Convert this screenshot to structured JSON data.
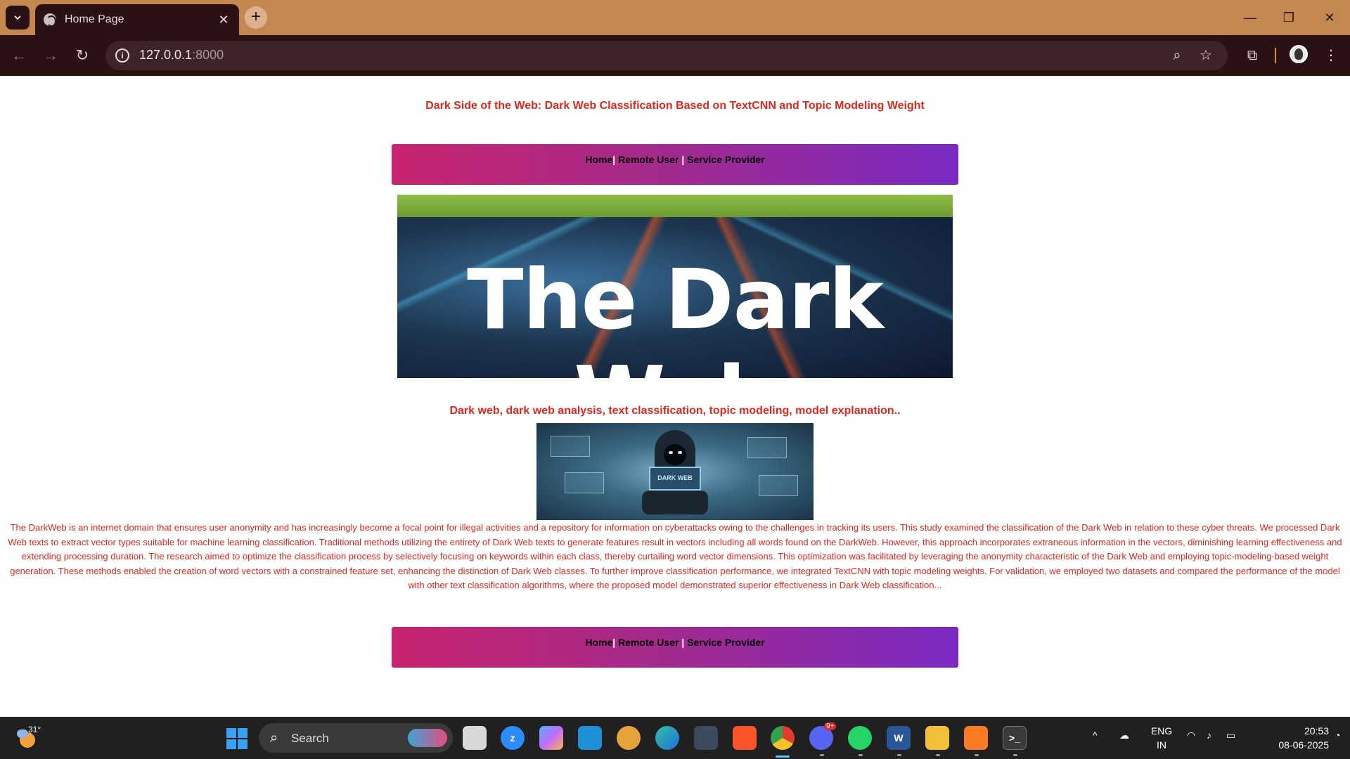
{
  "browser": {
    "tab_title": "Home Page",
    "url_host": "127.0.0.1",
    "url_port": ":8000"
  },
  "page": {
    "title": "Dark Side of the Web: Dark Web Classification Based on TextCNN and Topic Modeling Weight",
    "menu": {
      "home": "Home",
      "sep1": "|",
      "remote_user": "Remote User",
      "sep2": "|",
      "service_provider": "Service Provider"
    },
    "banner_text": "The Dark Web",
    "keywords": "Dark web, dark web analysis, text classification, topic modeling, model explanation..",
    "hacker_screen_text": "DARK WEB",
    "abstract": "The DarkWeb is an internet domain that ensures user anonymity and has increasingly become a focal point for illegal activities and a repository for information on cyberattacks owing to the challenges in tracking its users. This study examined the classification of the Dark Web in relation to these cyber threats. We processed Dark Web texts to extract vector types suitable for machine learning classification. Traditional methods utilizing the entirety of Dark Web texts to generate features result in vectors including all words found on the DarkWeb. However, this approach incorporates extraneous information in the vectors, diminishing learning effectiveness and extending processing duration. The research aimed to optimize the classification process by selectively focusing on keywords within each class, thereby curtailing word vector dimensions. This optimization was facilitated by leveraging the anonymity characteristic of the Dark Web and employing topic-modeling-based weight generation. These methods enabled the creation of word vectors with a constrained feature set, enhancing the distinction of Dark Web classes. To further improve classification performance, we integrated TextCNN with topic modeling weights. For validation, we employed two datasets and compared the performance of the model with other text classification algorithms, where the proposed model demonstrated superior effectiveness in Dark Web classification..."
  },
  "taskbar": {
    "weather_temp": "31°",
    "search_label": "Search",
    "discord_badge": "9+",
    "lang_line1": "ENG",
    "lang_line2": "IN",
    "time": "20:53",
    "date": "08-06-2025"
  },
  "colors": {
    "title_bar": "#c4874f",
    "chrome_dark": "#2a1214",
    "page_text_red": "#e0261e",
    "menu_gradient_start": "#c8246f",
    "menu_gradient_end": "#7a2ac3"
  },
  "icons": [
    "tab-list-icon",
    "globe-icon",
    "close-icon",
    "plus-icon",
    "minimize-icon",
    "restore-icon",
    "back-icon",
    "forward-icon",
    "reload-icon",
    "info-icon",
    "zoom-icon",
    "star-icon",
    "extensions-icon",
    "menu-dots-icon",
    "windows-start-icon",
    "search-icon"
  ]
}
